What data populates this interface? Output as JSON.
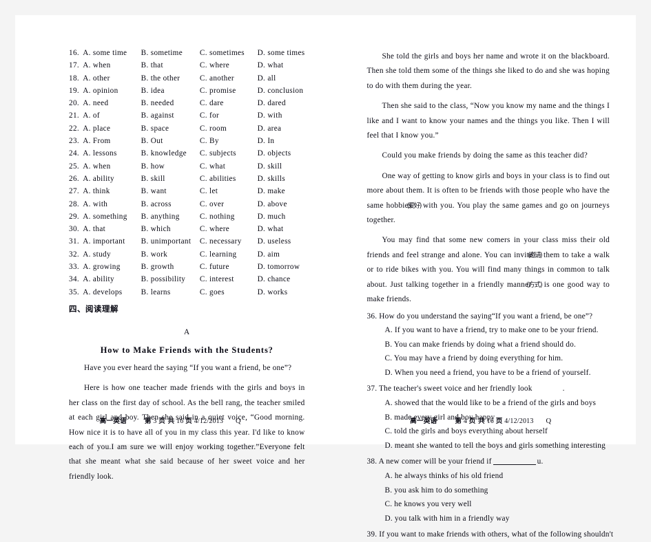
{
  "document": {
    "type": "scanned-exam-paper",
    "background_color": "#f4f4f4",
    "page_color": "#ffffff"
  },
  "cloze": {
    "columns": [
      "number",
      "A",
      "B",
      "C",
      "D"
    ],
    "rows": [
      {
        "num": "16.",
        "a": "A. some time",
        "b": "B. sometime",
        "c": "C. sometimes",
        "d": "D. some times"
      },
      {
        "num": "17.",
        "a": "A. when",
        "b": "B. that",
        "c": "C. where",
        "d": "D. what"
      },
      {
        "num": "18.",
        "a": "A. other",
        "b": "B. the other",
        "c": "C. another",
        "d": "D. all"
      },
      {
        "num": "19.",
        "a": "A. opinion",
        "b": "B. idea",
        "c": "C. promise",
        "d": "D. conclusion"
      },
      {
        "num": "20.",
        "a": "A. need",
        "b": "B. needed",
        "c": "C. dare",
        "d": "D. dared"
      },
      {
        "num": "21.",
        "a": "A. of",
        "b": "B. against",
        "c": "C. for",
        "d": "D. with"
      },
      {
        "num": "22.",
        "a": "A. place",
        "b": "B. space",
        "c": "C. room",
        "d": "D. area"
      },
      {
        "num": "23.",
        "a": "A. From",
        "b": "B. Out",
        "c": "C. By",
        "d": "D. In"
      },
      {
        "num": "24.",
        "a": "A. lessons",
        "b": "B. knowledge",
        "c": "C. subjects",
        "d": "D. objects"
      },
      {
        "num": "25.",
        "a": "A. when",
        "b": "B. how",
        "c": "C. what",
        "d": "D. skill"
      },
      {
        "num": "26.",
        "a": "A. ability",
        "b": "B. skill",
        "c": "C. abilities",
        "d": "D. skills"
      },
      {
        "num": "27.",
        "a": "A. think",
        "b": "B. want",
        "c": "C. let",
        "d": "D. make"
      },
      {
        "num": "28.",
        "a": "A. with",
        "b": "B. across",
        "c": "C. over",
        "d": "D. above"
      },
      {
        "num": "29.",
        "a": "A. something",
        "b": "B. anything",
        "c": "C. nothing",
        "d": "D. much"
      },
      {
        "num": "30.",
        "a": "A. that",
        "b": "B. which",
        "c": "C. where",
        "d": "D. what"
      },
      {
        "num": "31.",
        "a": "A. important",
        "b": "B. unimportant",
        "c": "C. necessary",
        "d": "D. useless"
      },
      {
        "num": "32.",
        "a": "A. study",
        "b": "B. work",
        "c": "C. learning",
        "d": "D. aim"
      },
      {
        "num": "33.",
        "a": "A. growing",
        "b": "B. growth",
        "c": "C. future",
        "d": "D. tomorrow"
      },
      {
        "num": "34.",
        "a": "A. ability",
        "b": "B. possibility",
        "c": "C. interest",
        "d": "D. chance"
      },
      {
        "num": "35.",
        "a": "A. develops",
        "b": "B. learns",
        "c": "C. goes",
        "d": "D. works"
      }
    ]
  },
  "reading_section": {
    "heading": "四、阅读理解",
    "passage_letter": "A",
    "title": "How to Make Friends with the Students?",
    "paragraphs": {
      "p1": "Have you ever heard the saying “If you want a friend, be one”?",
      "p2": "Here is how one teacher made friends with the girls and boys in her class on the first day of school. As the bell rang, the teacher smiled at each girl and boy. Then she said in a quiet voice, “Good morning. How nice it is to have all of you in my class this year. I'd like to know each of you.I am sure we will enjoy working together.”Everyone felt that she meant what she said because of her sweet voice and her friendly look.",
      "p3": "She told the girls and boys her name and wrote it on the blackboard. Then she told them some of the things she liked to do and she was hoping to do with them during the year.",
      "p4": "Then she said to the class, “Now you know my name and the things I like and I want to know your names and the things you like. Then I will feel that I know you.”",
      "p5": "Could you make friends by doing the same as this teacher did?",
      "p6_a": "One way of getting to know girls and boys in your class is to find out more about them. It is often to be friends with those people who have the same hobbies",
      "p6_annot1": "(爱好)",
      "p6_b": " with you. You play the same games and go on journeys together.",
      "p7_a": "You may find that some new comers in your class miss their old friends and feel strange and alone. You can invite",
      "p7_annot1": "(邀请)",
      "p7_b": " them to take a walk or to ride bikes with you. You will find many things in common to talk about. Just talking together in a friendly manner",
      "p7_annot2": "(方式)",
      "p7_c": " is one good way to make friends."
    },
    "questions": [
      {
        "stem": "36. How do you understand the saying“If you want a friend, be one”?",
        "options": [
          "A. If you want to have a friend, try to make one to be your friend.",
          "B. You can make friends by doing what a friend should do.",
          "C. You may have a friend by doing everything for him.",
          "D. When you need a friend, you have to be a friend of yourself."
        ]
      },
      {
        "stem": "37. The teacher's sweet voice and her friendly look",
        "stem_tail": ".",
        "options": [
          "A. showed that the would like to be a friend of the girls and boys",
          "B. made every girl and boy happy",
          "C. told the girls and boys everything about herself",
          "D. meant she wanted to tell the boys and girls something interesting"
        ]
      },
      {
        "stem_pre": "38. A new comer will be your friend if",
        "stem_post": "u.",
        "options": [
          "A. he always thinks of his old friend",
          "B. you ask him to do something",
          "C. he knows you very well",
          "D. you talk with him in a friendly way"
        ]
      },
      {
        "stem": "39. If you want to make friends with others, what of the following shouldn't",
        "options": []
      }
    ]
  },
  "footers": {
    "left": {
      "subject": "高一英语",
      "page_label_pre": "第",
      "page_number": "3",
      "page_label_mid": "页 共",
      "page_total": "16",
      "page_label_post": "页",
      "date": "4/12/2013",
      "mark": "Q"
    },
    "right": {
      "subject": "高一英语",
      "page_label_pre": "第",
      "page_number": "4",
      "page_label_mid": "页 共",
      "page_total": "16",
      "page_label_post": "页",
      "date": "4/12/2013",
      "mark": "Q"
    }
  }
}
